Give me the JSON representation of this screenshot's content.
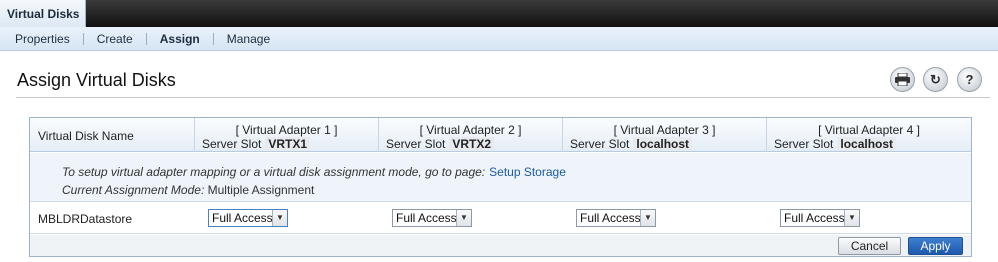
{
  "top_tab": "Virtual Disks",
  "subnav": [
    {
      "label": "Properties",
      "active": false
    },
    {
      "label": "Create",
      "active": false
    },
    {
      "label": "Assign",
      "active": true
    },
    {
      "label": "Manage",
      "active": false
    }
  ],
  "page_title": "Assign Virtual Disks",
  "toolbar_icons": [
    "print-icon",
    "refresh-icon",
    "help-icon"
  ],
  "table": {
    "name_header": "Virtual Disk Name",
    "adapters": [
      {
        "title": "[ Virtual Adapter 1 ]",
        "slot_label": "Server Slot",
        "slot_value": "VRTX1"
      },
      {
        "title": "[ Virtual Adapter 2 ]",
        "slot_label": "Server Slot",
        "slot_value": "VRTX2"
      },
      {
        "title": "[ Virtual Adapter 3 ]",
        "slot_label": "Server Slot",
        "slot_value": "localhost"
      },
      {
        "title": "[ Virtual Adapter 4 ]",
        "slot_label": "Server Slot",
        "slot_value": "localhost"
      }
    ],
    "info_text": "To setup virtual adapter mapping or a virtual disk assignment mode, go to page:",
    "info_link": "Setup Storage",
    "mode_label": "Current Assignment Mode:",
    "mode_value": "Multiple Assignment",
    "rows": [
      {
        "name": "MBLDRDatastore",
        "access": [
          "Full Access",
          "Full Access",
          "Full Access",
          "Full Access"
        ]
      }
    ]
  },
  "buttons": {
    "cancel": "Cancel",
    "apply": "Apply"
  }
}
